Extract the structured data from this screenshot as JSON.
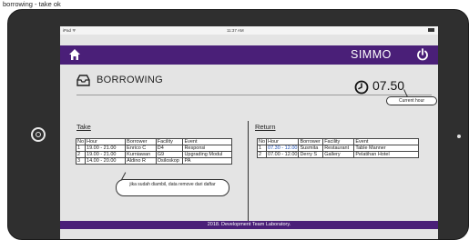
{
  "caption": "borrowing - take ok",
  "statusbar": {
    "device": "iPad ᯤ",
    "time": "11:37 AM"
  },
  "navbar": {
    "brand": "SIMMO"
  },
  "page": {
    "title": "BORROWING"
  },
  "clock": {
    "value": "07.50",
    "note": "Current hour"
  },
  "take": {
    "label": "Take",
    "headers": [
      "No",
      "Hour",
      "Borrower",
      "Facility",
      "Event"
    ],
    "rows": [
      [
        "1",
        "19.00 - 21.00",
        "Enrico C",
        "D4",
        "Responsi"
      ],
      [
        "2",
        "19.00 - 21.00",
        "Kurniawan",
        "G9",
        "Upgrading Modul"
      ],
      [
        "3",
        "14.00 - 20.00",
        "Aldino R",
        "Osiloskop",
        "PA"
      ]
    ],
    "note": "jika sudah diambil, data remove dari daftar"
  },
  "return": {
    "label": "Return",
    "headers": [
      "No",
      "Hour",
      "Borrower",
      "Facility",
      "Event"
    ],
    "rows": [
      [
        "1",
        "07.30 - 12.00",
        "Susmita",
        "Restaurant",
        "Table Manner"
      ],
      [
        "2",
        "07.00 - 12.00",
        "Derry S",
        "Gallery",
        "Pelatihan Hotel"
      ]
    ]
  },
  "footer": {
    "text": "2018. Development Team Laboratory."
  },
  "colors": {
    "nav": "#4a1f78",
    "screen": "#e4e4e4",
    "bezel": "#2f2f2f",
    "link": "#1a4db3"
  }
}
